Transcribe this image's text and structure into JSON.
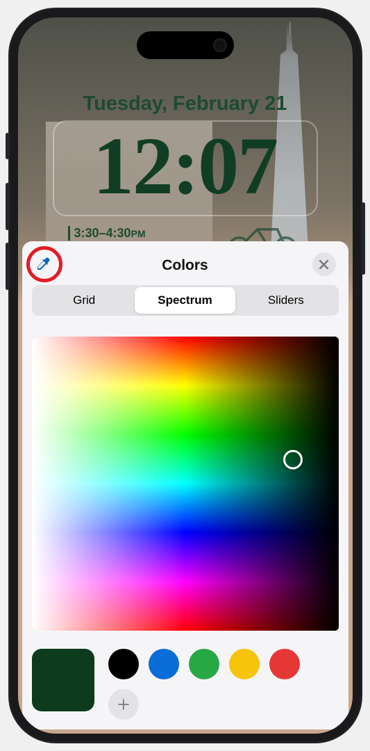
{
  "lockscreen": {
    "date": "Tuesday, February 21",
    "time": "12:07",
    "subline_time": "3:30–4:30",
    "subline_ampm": "PM"
  },
  "sheet": {
    "title": "Colors",
    "tabs": {
      "grid": "Grid",
      "spectrum": "Spectrum",
      "sliders": "Sliders"
    }
  },
  "colors": {
    "current": "#0c3b1e",
    "presets": [
      "#000000",
      "#0a6cd6",
      "#28a745",
      "#f7c40a",
      "#e63737"
    ]
  },
  "icons": {
    "eyedropper": "eyedropper-icon",
    "close": "close-icon",
    "add": "plus-icon",
    "bike": "bike-icon"
  }
}
